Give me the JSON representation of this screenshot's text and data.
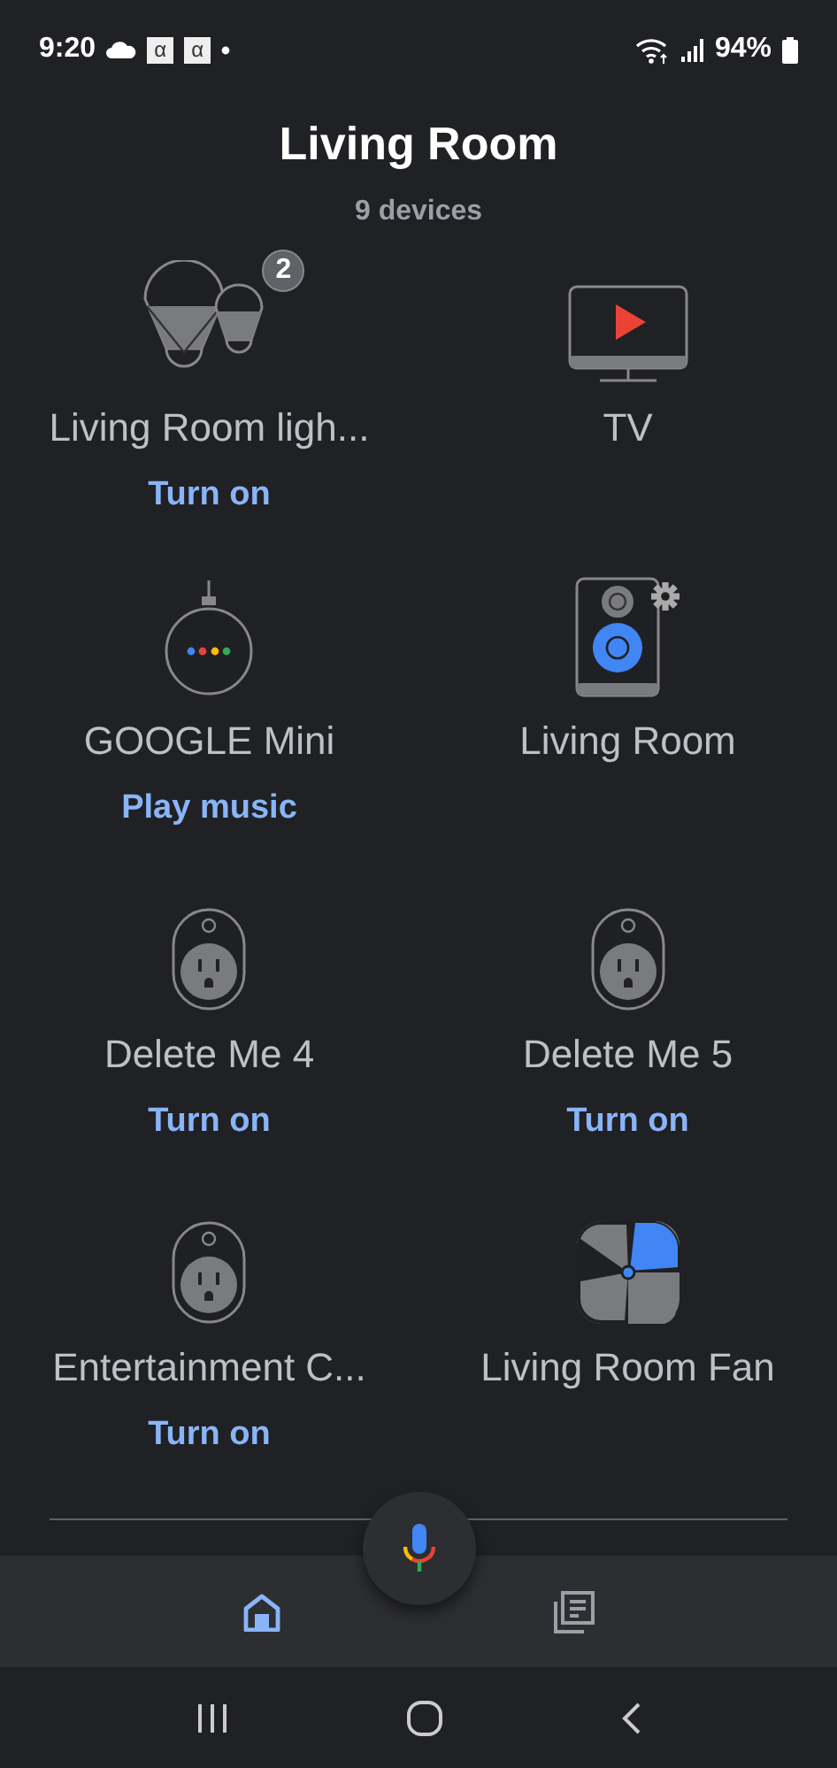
{
  "status_bar": {
    "time": "9:20",
    "notification_glyphs": [
      "α",
      "α"
    ],
    "battery": "94%"
  },
  "header": {
    "title": "Living Room",
    "subtitle": "9 devices"
  },
  "devices": [
    {
      "kind": "lights",
      "name": "Living Room ligh...",
      "badge": "2",
      "action": "Turn on"
    },
    {
      "kind": "tv",
      "name": "TV"
    },
    {
      "kind": "speaker",
      "name": "GOOGLE Mini",
      "action": "Play music"
    },
    {
      "kind": "speaker_group",
      "name": "Living Room"
    },
    {
      "kind": "outlet",
      "name": "Delete Me 4",
      "action": "Turn on"
    },
    {
      "kind": "outlet",
      "name": "Delete Me 5",
      "action": "Turn on"
    },
    {
      "kind": "outlet",
      "name": "Entertainment C...",
      "action": "Turn on"
    },
    {
      "kind": "fan",
      "name": "Living Room Fan"
    }
  ],
  "bottom_nav": [
    {
      "kind": "home",
      "selected": true
    },
    {
      "kind": "feed",
      "selected": false
    }
  ]
}
